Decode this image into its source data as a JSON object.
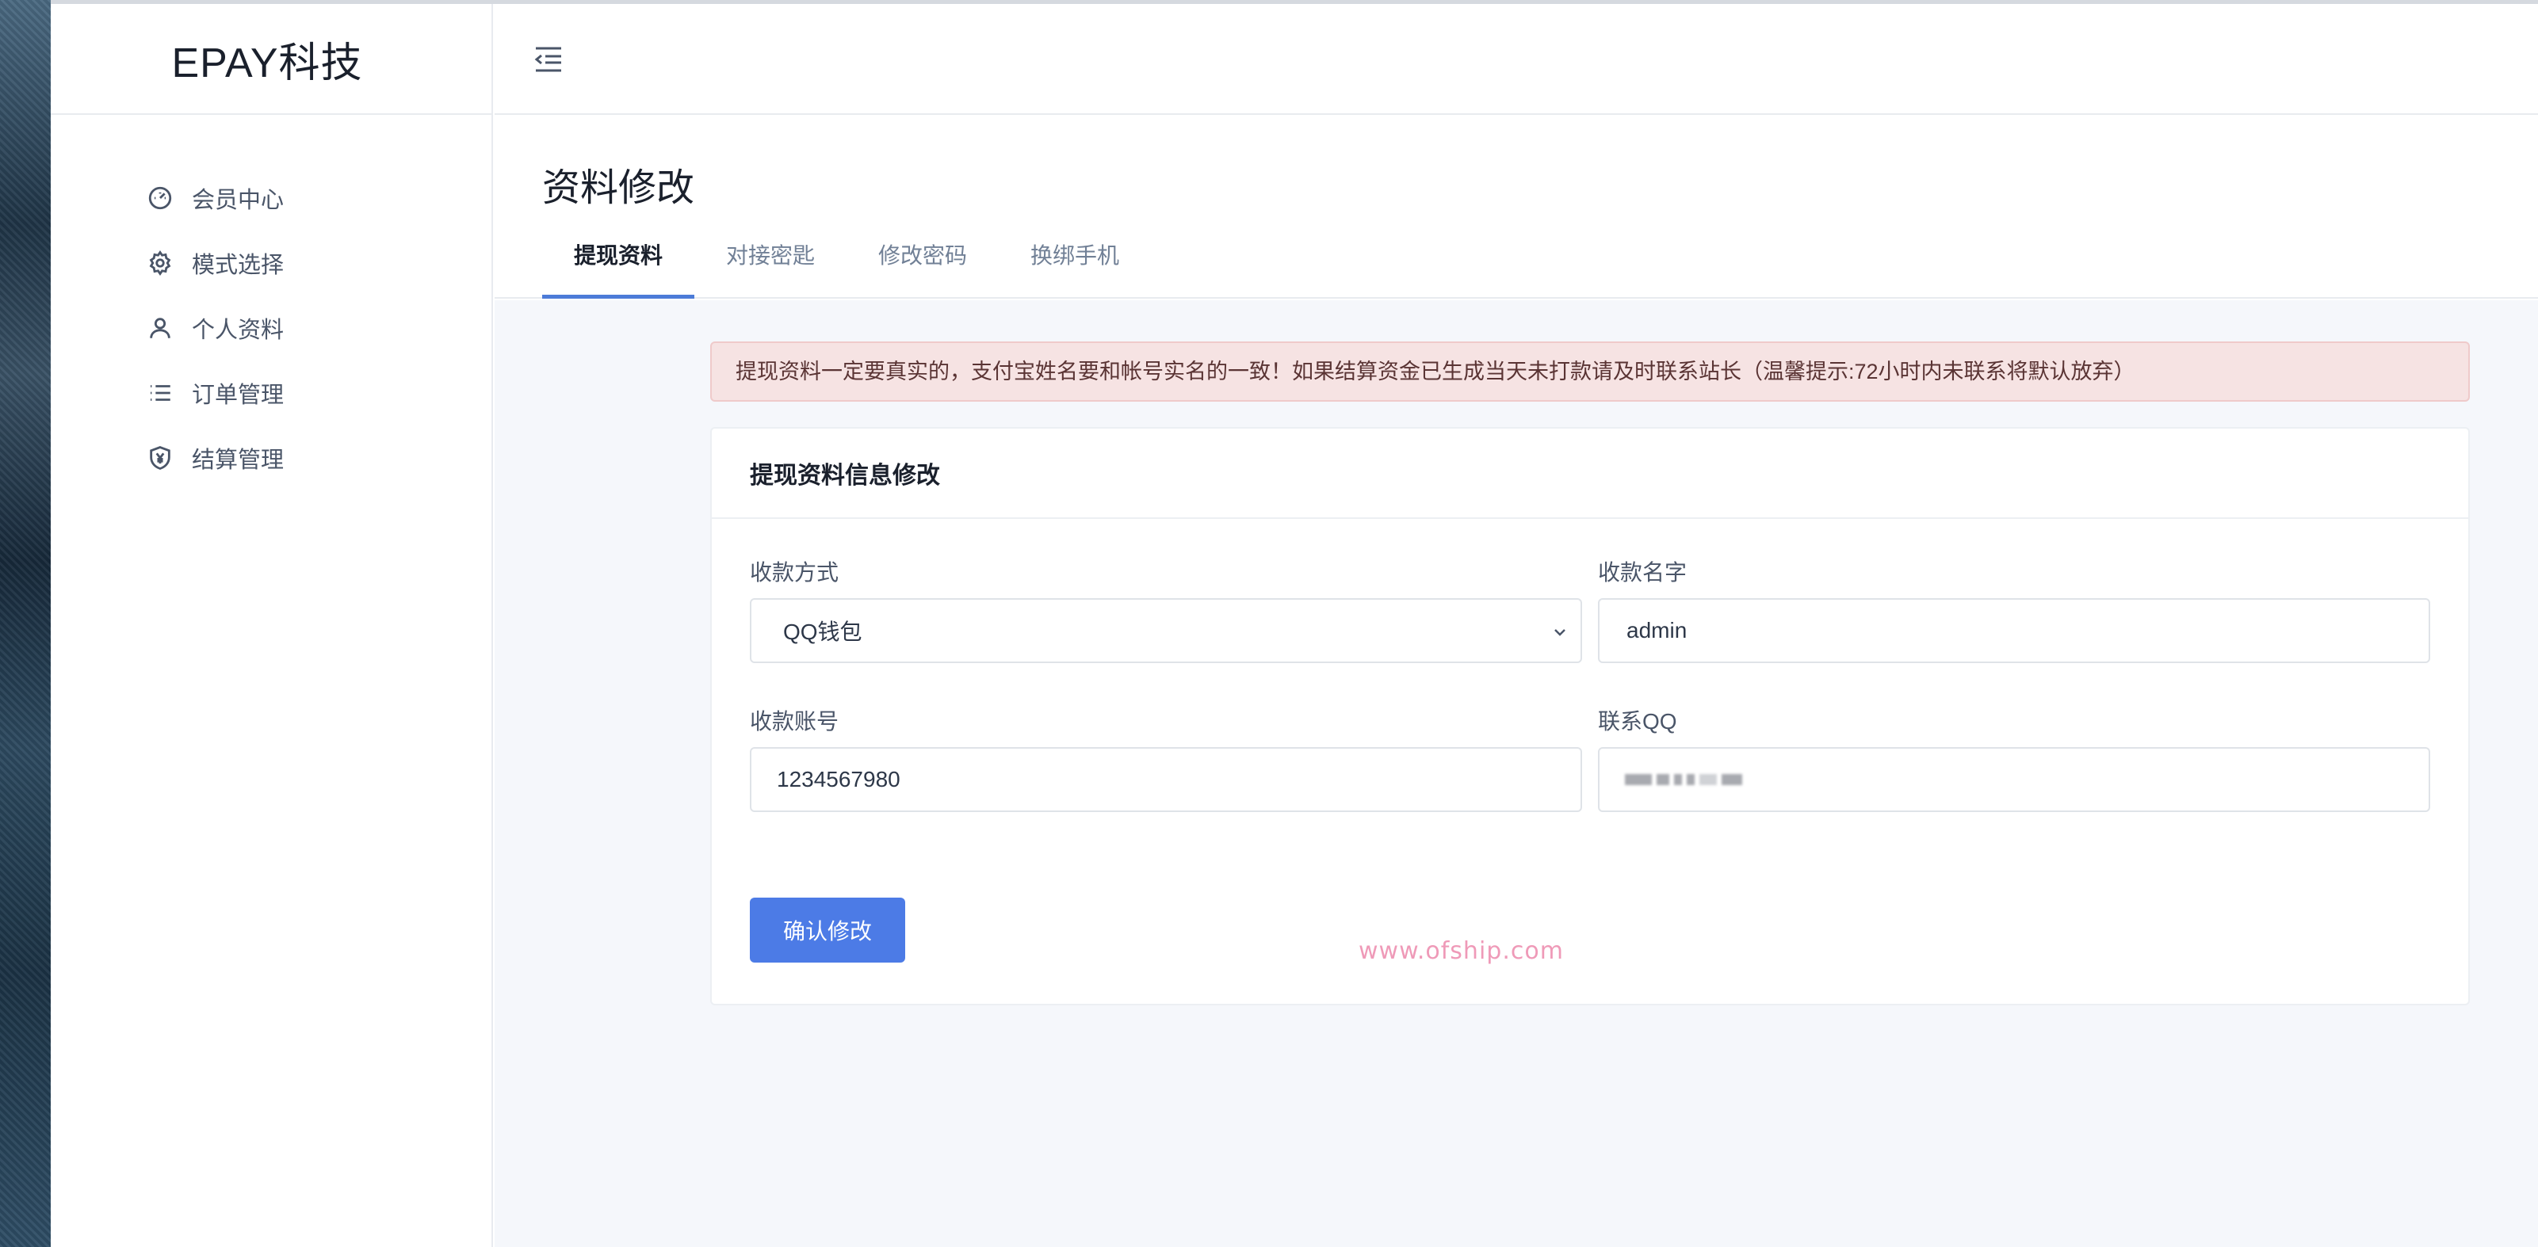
{
  "brand": {
    "title": "EPAY科技"
  },
  "sidebar": {
    "items": [
      {
        "label": "会员中心",
        "icon": "dashboard-gauge-icon"
      },
      {
        "label": "模式选择",
        "icon": "gear-icon"
      },
      {
        "label": "个人资料",
        "icon": "user-icon"
      },
      {
        "label": "订单管理",
        "icon": "list-icon"
      },
      {
        "label": "结算管理",
        "icon": "yen-shield-icon"
      }
    ]
  },
  "header": {
    "toggle_icon": "menu-collapse-icon"
  },
  "page": {
    "title": "资料修改",
    "tabs": [
      {
        "label": "提现资料",
        "active": true
      },
      {
        "label": "对接密匙",
        "active": false
      },
      {
        "label": "修改密码",
        "active": false
      },
      {
        "label": "换绑手机",
        "active": false
      }
    ]
  },
  "alert": {
    "text": "提现资料一定要真实的，支付宝姓名要和帐号实名的一致！如果结算资金已生成当天未打款请及时联系站长（温馨提示:72小时内未联系将默认放弃）",
    "color": "#f6e3e3"
  },
  "form": {
    "title": "提现资料信息修改",
    "method_label": "收款方式",
    "method_value": "QQ钱包",
    "name_label": "收款名字",
    "name_value": "admin",
    "account_label": "收款账号",
    "account_value": "1234567980",
    "qq_label": "联系QQ",
    "submit_label": "确认修改"
  },
  "watermark": "www.ofship.com",
  "colors": {
    "accent": "#4c7be6",
    "tab_underline": "#4c7bd8"
  }
}
